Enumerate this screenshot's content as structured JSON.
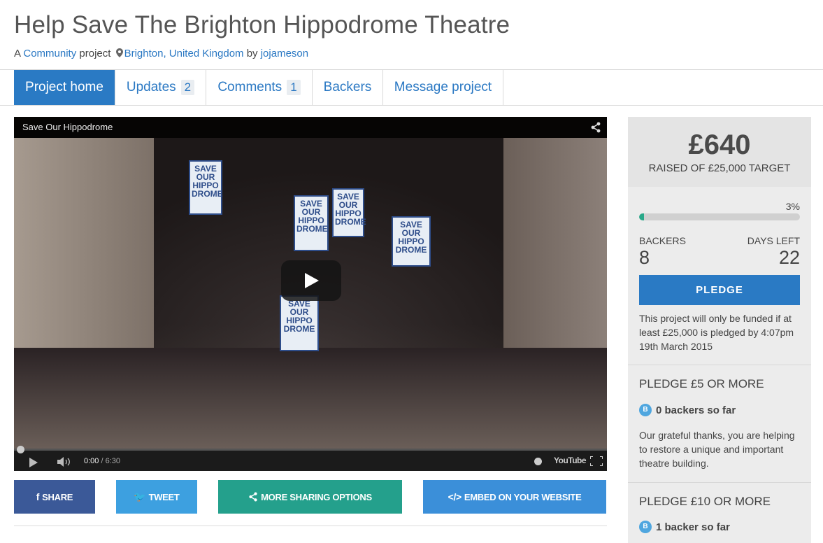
{
  "project": {
    "title": "Help Save The Brighton Hippodrome Theatre",
    "meta_prefix": "A",
    "category": "Community",
    "meta_mid": "project",
    "location": "Brighton, United Kingdom",
    "meta_by": "by",
    "author": "jojameson"
  },
  "tabs": [
    {
      "label": "Project home",
      "count": null
    },
    {
      "label": "Updates",
      "count": "2"
    },
    {
      "label": "Comments",
      "count": "1"
    },
    {
      "label": "Backers",
      "count": null
    },
    {
      "label": "Message project",
      "count": null
    }
  ],
  "video": {
    "title": "Save Our Hippodrome",
    "current_time": "0:00",
    "duration": "/ 6:30",
    "provider": "YouTube",
    "sign_text": "SAVE OUR HIPPO DROME"
  },
  "share_buttons": {
    "share": "SHARE",
    "tweet": "TWEET",
    "more": "MORE SHARING OPTIONS",
    "embed": "EMBED ON YOUR WEBSITE"
  },
  "colors": {
    "facebook": "#3b5998",
    "twitter": "#3da0e0",
    "more": "#24a08c",
    "embed": "#3b8fd9",
    "accent": "#2a7ac4"
  },
  "funding": {
    "amount": "£640",
    "raised_label": "RAISED OF £25,000 TARGET",
    "percent_label": "3%",
    "percent_value": 3,
    "backers_label": "BACKERS",
    "backers": "8",
    "days_label": "DAYS LEFT",
    "days": "22",
    "pledge_label": "PLEDGE",
    "note": "This project will only be funded if at least £25,000 is pledged by 4:07pm 19th March 2015"
  },
  "rewards": [
    {
      "title": "PLEDGE £5 OR MORE",
      "backers": "0 backers so far",
      "description": "Our grateful thanks, you are helping to restore a unique and important theatre building."
    },
    {
      "title": "PLEDGE £10 OR MORE",
      "backers": "1 backer so far"
    }
  ]
}
